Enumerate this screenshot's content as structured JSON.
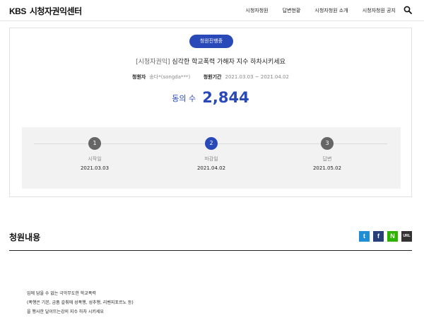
{
  "header": {
    "logo_mark": "KBS",
    "logo_title": "시청자권익센터",
    "nav": [
      "시청자청원",
      "답변현황",
      "시청자청원 소개",
      "시청자청원 공지"
    ]
  },
  "petition": {
    "status": "청원진행중",
    "category": "[시청자권익]",
    "title": "심각한 학교폭력 가해자 지수 하차시키세요",
    "petitioner_label": "청원자",
    "petitioner": "송다*(songda***)",
    "period_label": "청원기간",
    "period": "2021.03.03 ~ 2021.04.02",
    "agree_label": "동의 수",
    "agree_count": "2,844"
  },
  "timeline": [
    {
      "num": "1",
      "label": "시작일",
      "date": "2021.03.03",
      "active": false
    },
    {
      "num": "2",
      "label": "마감일",
      "date": "2021.04.02",
      "active": true
    },
    {
      "num": "3",
      "label": "답변",
      "date": "2021.05.02",
      "active": false
    }
  ],
  "content": {
    "section_title": "청원내용",
    "share": {
      "twitter": "t",
      "facebook": "f",
      "naver": "N",
      "url": "URL"
    },
    "lines": [
      "입에 담을 수 없는 극악무도한 학교폭력",
      "(폭행은 기본, 금품 갈취에 성폭행, 성추행, 리벤지포르노 등)",
      "을 행사한 달이뜨는강의 지수 하차 시키세요"
    ]
  },
  "colors": {
    "accent": "#2a49b8"
  }
}
